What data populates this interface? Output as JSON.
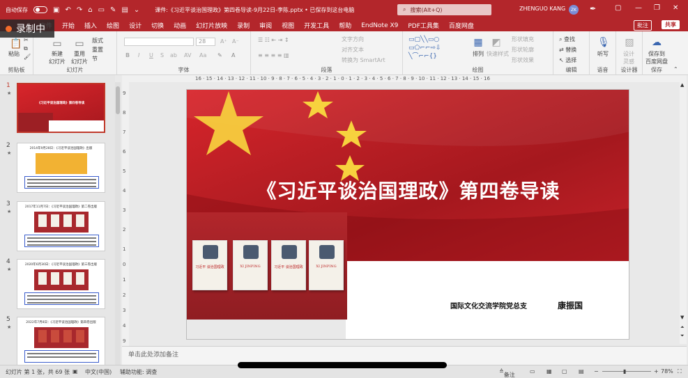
{
  "titlebar": {
    "autosave_label": "自动保存",
    "autosave_state": "关",
    "document_title": "课件:《习近平谈治国理政》第四卷导读-9月22日-李陈.pptx • 已保存到这台电脑",
    "search_placeholder": "搜索(Alt+Q)",
    "user_name": "ZHENGUO KANG",
    "user_initials": "ZK"
  },
  "recording": {
    "label": "录制中"
  },
  "menu": {
    "items": [
      "文件",
      "开始",
      "插入",
      "绘图",
      "设计",
      "切换",
      "动画",
      "幻灯片放映",
      "录制",
      "审阅",
      "视图",
      "开发工具",
      "帮助",
      "EndNote X9",
      "PDF工具集",
      "百度网盘"
    ],
    "comment_label": "批注",
    "share_label": "共享"
  },
  "ribbon": {
    "groups": [
      "剪贴板",
      "幻灯片",
      "字体",
      "段落",
      "绘图",
      "编辑",
      "语音",
      "设计器",
      "保存"
    ],
    "clipboard": {
      "paste": "粘贴"
    },
    "slides": {
      "new": "新建\n幻灯片",
      "reuse": "重用\n幻灯片",
      "layout": "版式",
      "reset": "重置",
      "section": "节"
    },
    "font": {
      "size": "28"
    },
    "paragraph": {
      "text_direction": "文字方向",
      "align_text": "对齐文本",
      "smartart": "转换为 SmartArt"
    },
    "drawing": {
      "arrange": "排列",
      "quick_styles": "快速样式",
      "fill": "形状填充",
      "outline": "形状轮廓",
      "effects": "形状效果"
    },
    "editing": {
      "find": "查找",
      "replace": "替换",
      "select": "选择"
    },
    "voice": {
      "dictate": "听写"
    },
    "designer": {
      "ideas": "设计\n灵感"
    },
    "save": {
      "baidu": "保存到\n百度网盘"
    }
  },
  "ruler": {
    "marks": "16 · 15 · 14 · 13 · 12 · 11 · 10 · 9 · 8 · 7 · 6 · 5 · 4 · 3 · 2 · 1 · 0 · 1 · 2 · 3 · 4 · 5 · 6 · 7 · 8 · 9 · 10 · 11 · 12 · 13 · 14 · 15 · 16"
  },
  "thumbnails": [
    {
      "num": "1",
      "title": "《习近平谈治国理政》第四卷导读"
    },
    {
      "num": "2",
      "title": "2014年9月28日：《习近平谈治国理政》出版"
    },
    {
      "num": "3",
      "title": "2017年11月7日：《习近平谈治国理政》第二卷出版"
    },
    {
      "num": "4",
      "title": "2020年6月30日：《习近平谈治国理政》第三卷出版"
    },
    {
      "num": "5",
      "title": "2022年7月8日：《习近平谈治国理政》第四卷出版"
    }
  ],
  "slide": {
    "title": "《习近平谈治国理政》第四卷导读",
    "author": "国际文化交流学院党总支",
    "signature": "康振国",
    "books": [
      "习近平 谈治国理政",
      "XI JINPING",
      "习近平 谈治国理政",
      "XI JINPING"
    ]
  },
  "notes": {
    "placeholder": "单击此处添加备注"
  },
  "status": {
    "slide_counter": "幻灯片 第 1 张，共 69 张",
    "language": "中文(中国)",
    "accessibility": "辅助功能: 调查",
    "notes_btn": "备注",
    "zoom": "78%"
  }
}
